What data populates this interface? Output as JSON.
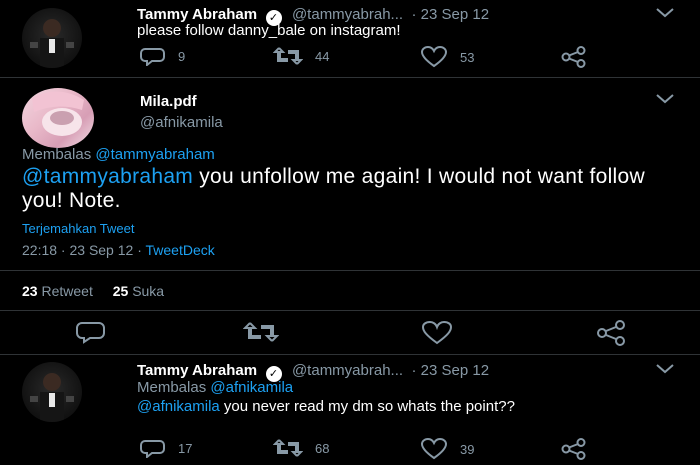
{
  "tweet1": {
    "name": "Tammy Abraham",
    "handle": "@tammyabrah...",
    "date": "· 23 Sep 12",
    "text": "please follow danny_bale on instagram!",
    "replies": "9",
    "retweets": "44",
    "likes": "53"
  },
  "main_tweet": {
    "name": "Mila.pdf",
    "handle": "@afnikamila",
    "reply_prefix": "Membalas",
    "reply_to": "@tammyabraham",
    "mention": "@tammyabraham",
    "text": " you unfollow me again! I would not want follow you! Note.",
    "translate": "Terjemahkan Tweet",
    "time": "22:18 · 23 Sep 12 · ",
    "source": "TweetDeck",
    "retweet_count": "23",
    "retweet_label": "Retweet",
    "like_count": "25",
    "like_label": "Suka"
  },
  "tweet3": {
    "name": "Tammy Abraham",
    "handle": "@tammyabrah...",
    "date": "· 23 Sep 12",
    "reply_prefix": "Membalas",
    "reply_to": "@afnikamila",
    "mention": "@afnikamila",
    "text": " you never read my dm so whats the point??",
    "replies": "17",
    "retweets": "68",
    "likes": "39"
  },
  "colors": {
    "accent": "#1da1f2",
    "muted": "#8899a6",
    "background": "#000000"
  },
  "icons": [
    "reply-icon",
    "retweet-icon",
    "like-icon",
    "share-icon",
    "chevron-down-icon",
    "verified-icon"
  ]
}
